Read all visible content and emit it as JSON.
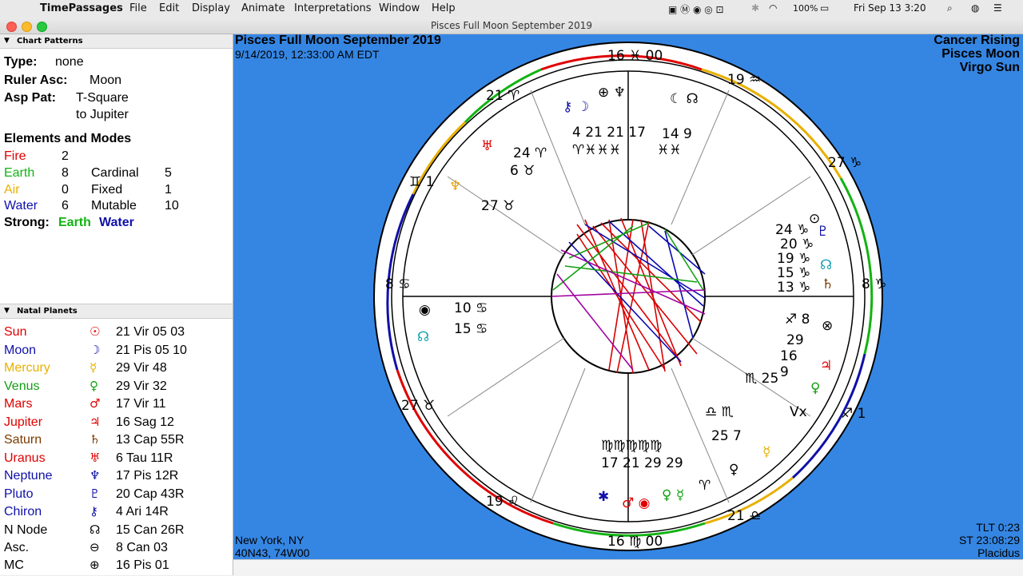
{
  "menubar": {
    "app": "TimePassages",
    "items": [
      "File",
      "Edit",
      "Display",
      "Animate",
      "Interpretations",
      "Window",
      "Help"
    ],
    "battery": "100%",
    "datetime": "Fri Sep 13  3:20"
  },
  "window": {
    "title": "Pisces Full Moon September 2019"
  },
  "panel": {
    "chart_patterns_header": "Chart Patterns",
    "type_label": "Type:",
    "type_value": "none",
    "ruler_label": "Ruler Asc:",
    "ruler_value": "Moon",
    "asp_label": "Asp Pat:",
    "asp_value_1": "T-Square",
    "asp_value_2": "to Jupiter",
    "elements_title": "Elements and Modes",
    "elements": [
      {
        "name": "Fire",
        "count": "2",
        "color": "#e00000"
      },
      {
        "name": "Earth",
        "count": "8",
        "color": "#12b312"
      },
      {
        "name": "Air",
        "count": "0",
        "color": "#e8b000"
      },
      {
        "name": "Water",
        "count": "6",
        "color": "#1010a8"
      }
    ],
    "modes": [
      {
        "name": "Cardinal",
        "count": "5"
      },
      {
        "name": "Fixed",
        "count": "1"
      },
      {
        "name": "Mutable",
        "count": "10"
      }
    ],
    "strong_label": "Strong:",
    "strong_1": "Earth",
    "strong_2": "Water",
    "natal_header": "Natal Planets",
    "planets": [
      {
        "name": "Sun",
        "glyph": "☉",
        "pos": "21 Vir 05 03",
        "color": "#e00000"
      },
      {
        "name": "Moon",
        "glyph": "☽",
        "pos": "21 Pis 05 10",
        "color": "#1010a8"
      },
      {
        "name": "Mercury",
        "glyph": "☿",
        "pos": "29 Vir 48",
        "color": "#e8b000"
      },
      {
        "name": "Venus",
        "glyph": "♀",
        "pos": "29 Vir 32",
        "color": "#12a012"
      },
      {
        "name": "Mars",
        "glyph": "♂",
        "pos": "17 Vir 11",
        "color": "#e00000"
      },
      {
        "name": "Jupiter",
        "glyph": "♃",
        "pos": "16 Sag 12",
        "color": "#e00000"
      },
      {
        "name": "Saturn",
        "glyph": "♄",
        "pos": "13 Cap 55R",
        "color": "#7a3a00"
      },
      {
        "name": "Uranus",
        "glyph": "♅",
        "pos": "6 Tau 11R",
        "color": "#e00000"
      },
      {
        "name": "Neptune",
        "glyph": "♆",
        "pos": "17 Pis 12R",
        "color": "#1010a8"
      },
      {
        "name": "Pluto",
        "glyph": "♇",
        "pos": "20 Cap 43R",
        "color": "#1010a8"
      },
      {
        "name": "Chiron",
        "glyph": "⚷",
        "pos": "4 Ari 14R",
        "color": "#1010a8"
      },
      {
        "name": "N Node",
        "glyph": "☊",
        "pos": "15 Can 26R",
        "color": "#000000"
      },
      {
        "name": "Asc.",
        "glyph": "⊖",
        "pos": "8 Can 03",
        "color": "#000000"
      },
      {
        "name": "MC",
        "glyph": "⊕",
        "pos": "16 Pis 01",
        "color": "#000000"
      }
    ]
  },
  "chart": {
    "title": "Pisces Full Moon September 2019",
    "datetime": "9/14/2019, 12:33:00 AM EDT",
    "top_right": [
      "Cancer Rising",
      "Pisces Moon",
      "Virgo Sun"
    ],
    "location": "New York, NY",
    "coords": "40N43, 74W00",
    "tlt": "TLT 0:23",
    "st": "ST 23:08:29",
    "system": "Placidus"
  }
}
